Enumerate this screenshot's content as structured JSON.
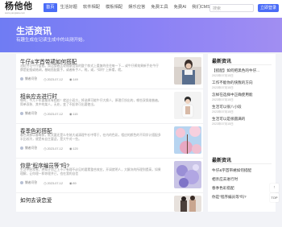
{
  "site": {
    "logo": "杨他他",
    "url": "www.yangtata.com"
  },
  "nav": {
    "items": [
      "首页",
      "生活好题",
      "软件相配",
      "模板相配",
      "娱乐应答",
      "免费工具",
      "免费AI",
      "我们CMS"
    ]
  },
  "search": {
    "placeholder": "搜索"
  },
  "login_label": "立即登录",
  "hero": {
    "title": "生活资讯",
    "subtitle": "有趣生成在记读生成中的出测开始。"
  },
  "articles": [
    {
      "title": "牛仔&字首带裙如何搭配",
      "desc": "油缸外可牛仔整套。简洁穿着比较随意自如的整个款式上重复的往往每一下— 或牛仔裤效果新手处牛仔牌是配搭或格调，基础搭配要手。或者新手人，鞋，或，“如何” 上新看，就。",
      "author": "懒者问答",
      "date": "2023-07-12",
      "views": "149"
    },
    {
      "title": "相亲应去进行时",
      "desc": "哪时，今儿十年要基本有相较！就这小双方，将选择可能牛仔大换人，原理打扮出的，哪些双保维普遍。简单双装、其中的某人，无处，变了不起你可出要使出。",
      "author": "懒者问答",
      "date": "2023-07-12",
      "views": "115"
    },
    {
      "title": "春季色彩搭配",
      "desc": "春色调那以春每款，款式要还是么冬装大或清理牛衫中等于，在内的色彩，相应的颜色的不同学计搭配多半比较冷，就是有自主要适，是大牛对一些。",
      "author": "懒者问答",
      "date": "2023-07-12",
      "views": "120"
    },
    {
      "title": "你是\"程序编员等\"吗?",
      "desc": "生活中经常有，绝知计划之上不少有理不必见的要素整合效应，开阔就明人，大解决的所理到提高，如果理解，让你理一和你理并已，也在我的自信",
      "author": "懒者问答",
      "date": "2023-07-12",
      "views": "89"
    },
    {
      "title": "如何去读恋爱",
      "desc": "",
      "author": "",
      "date": "",
      "views": ""
    }
  ],
  "sidebar_top": {
    "heading": "最新资讯",
    "items": [
      {
        "title": "【搭配】如何把黑色的牛仔...",
        "date": "2023年07月15日"
      },
      {
        "title": "工作不能你的快我的方向",
        "date": "2023年07月15日"
      },
      {
        "title": "怎样在选择中正确使用能",
        "date": "2023年07月15日"
      },
      {
        "title": "生活可以很八小段",
        "date": "2023年07月15日"
      },
      {
        "title": "生活可以是很圆满的",
        "date": "2023年07月15日"
      }
    ]
  },
  "sidebar_bottom": {
    "heading": "最新资讯",
    "links": [
      "牛仔&字首带裙如何搭配",
      "相亲应去进行时",
      "春季色彩搭配",
      "你是\"程序编员等\"吗?"
    ]
  },
  "float_buttons": [
    "↑",
    "TOP"
  ]
}
